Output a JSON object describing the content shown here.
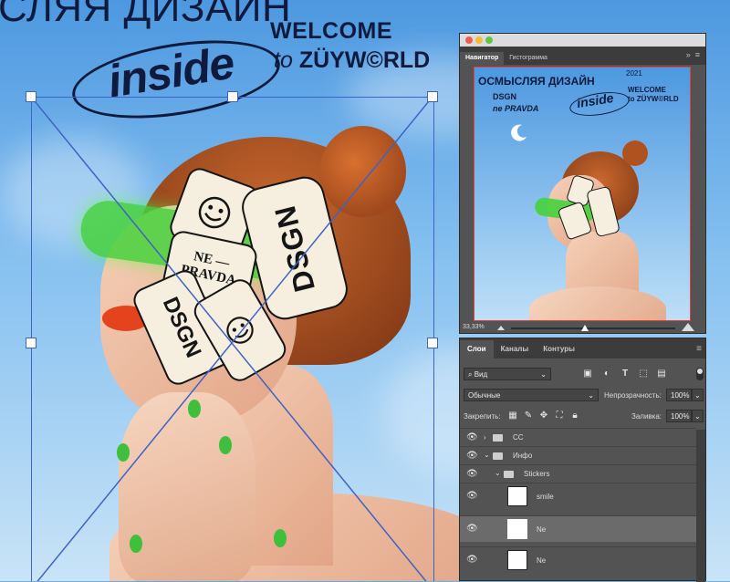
{
  "artwork": {
    "title": "СЛЯЯ ДИЗАЙН",
    "welcome": "WELCOME",
    "to": "to",
    "world": "ZÜYW©RLD",
    "inside": "inside",
    "stickers": {
      "ne_pravda_top": "NE —",
      "ne_pravda_bottom": "PRAVDA",
      "dsgn": "DSGN"
    }
  },
  "navigator": {
    "tabs": [
      "Навигатор",
      "Гистограмма"
    ],
    "menu_icon": "collapse-icon",
    "preview": {
      "title": "ОСМЫСЛЯЯ ДИЗАЙН",
      "year": "2021",
      "dsgn": "DSGN",
      "ne_pravda": "ne PRAVDA",
      "welcome": "WELCOME",
      "world": "to ZÜYW©RLD",
      "inside": "inside"
    },
    "zoom": "33,33%",
    "zoom_slider_fraction": 0.45
  },
  "layers": {
    "tabs": [
      "Слои",
      "Каналы",
      "Контуры"
    ],
    "filter_label": "Вид",
    "blend_mode": "Обычные",
    "opacity_label": "Непрозрачность:",
    "opacity_value": "100%",
    "lock_label": "Закрепить:",
    "fill_label": "Заливка:",
    "fill_value": "100%",
    "items": [
      {
        "name": "CC",
        "type": "group",
        "expanded": false
      },
      {
        "name": "Инфо",
        "type": "group",
        "expanded": true
      },
      {
        "name": "Stickers",
        "type": "group",
        "expanded": true
      },
      {
        "name": "smile",
        "type": "layer"
      },
      {
        "name": "Ne",
        "type": "layer",
        "selected": true
      },
      {
        "name": "Ne",
        "type": "layer"
      }
    ]
  },
  "colors": {
    "panel_bg": "#535353",
    "panel_dark": "#3c3c3c",
    "transform_box": "#3f62c4",
    "navigator_frame": "#e04040",
    "headline": "#0f1a3c"
  }
}
